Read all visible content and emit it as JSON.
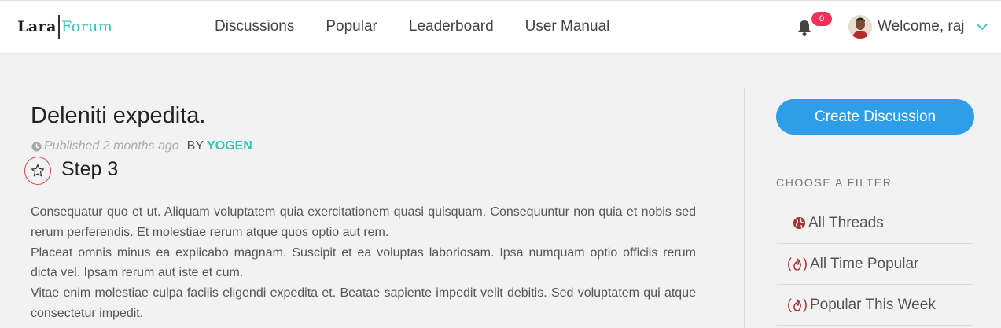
{
  "brand": {
    "part1": "Lara",
    "part2": "Forum"
  },
  "nav": {
    "links": [
      "Discussions",
      "Popular",
      "Leaderboard",
      "User Manual"
    ]
  },
  "notifications": {
    "count": "0"
  },
  "user": {
    "welcome": "Welcome, raj"
  },
  "thread": {
    "title": "Deleniti expedita.",
    "published": "Published 2 months ago",
    "by": "BY",
    "author": "YOGEN",
    "step": "Step 3",
    "paragraphs": [
      "Consequatur quo et ut. Aliquam voluptatem quia exercitationem quasi quisquam. Consequuntur non quia et nobis sed rerum perferendis. Et molestiae rerum atque quos optio aut rem.",
      "Placeat omnis minus ea explicabo magnam. Suscipit et ea voluptas laboriosam. Ipsa numquam optio officiis rerum dicta vel. Ipsam rerum aut iste et cum.",
      "Vitae enim molestiae culpa facilis eligendi expedita et. Beatae sapiente impedit velit debitis. Sed voluptatem qui atque consectetur impedit."
    ]
  },
  "sidebar": {
    "create_label": "Create Discussion",
    "filter_heading": "CHOOSE A FILTER",
    "filters": [
      {
        "label": "All Threads",
        "icon": "globe-icon"
      },
      {
        "label": "All Time Popular",
        "icon": "fire-icon"
      },
      {
        "label": "Popular This Week",
        "icon": "fire-icon"
      }
    ]
  },
  "colors": {
    "accent": "#2ec4b6",
    "primary_button": "#2f9ee8",
    "badge": "#f0325a",
    "fire": "#a33333"
  }
}
